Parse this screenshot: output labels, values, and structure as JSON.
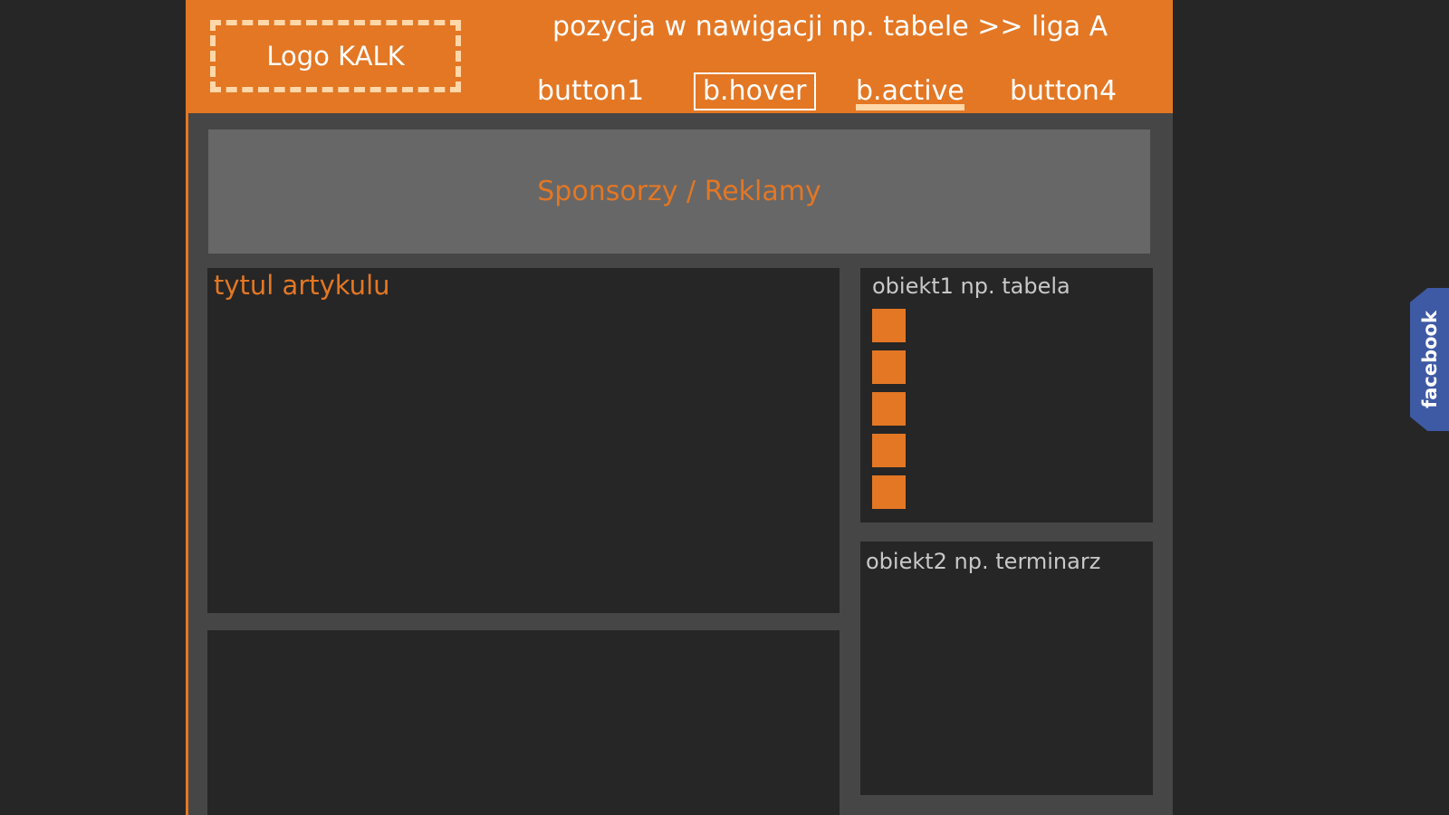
{
  "header": {
    "logo": "Logo KALK",
    "breadcrumb": "pozycja w nawigacji np. tabele >> liga A",
    "nav": [
      "button1",
      "b.hover",
      "b.active",
      "button4"
    ]
  },
  "sponsors": "Sponsorzy / Reklamy",
  "article": {
    "title": "tytul artykulu"
  },
  "sidebar": {
    "obj1_title": "obiekt1 np. tabela",
    "obj2_title": "obiekt2 np. terminarz"
  },
  "facebook_tab": "facebook",
  "colors": {
    "accent": "#e37724",
    "page_bg": "#262626",
    "content_bg": "#464646",
    "sponsor_bg": "#676767",
    "logo_border": "#ffd7a8",
    "facebook": "#3f5aa4"
  }
}
